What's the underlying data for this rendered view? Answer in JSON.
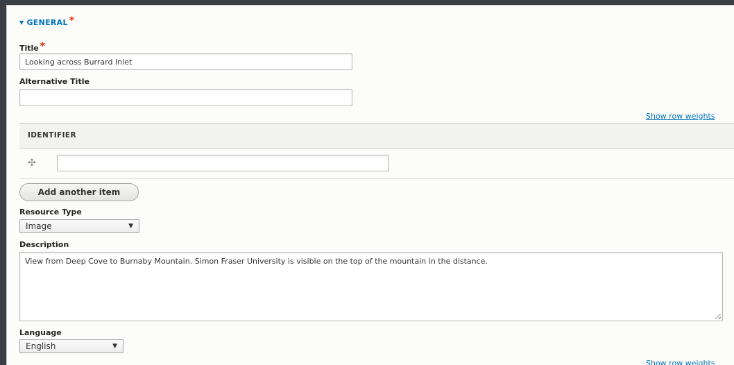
{
  "section": {
    "label": "GENERAL",
    "required_marker": "*"
  },
  "title": {
    "label": "Title",
    "required_marker": "*",
    "value": "Looking across Burrard Inlet"
  },
  "alternative_title": {
    "label": "Alternative Title",
    "value": ""
  },
  "identifier": {
    "show_weights": "Show row weights",
    "header": "IDENTIFIER",
    "value": ""
  },
  "add_item": {
    "label": "Add another item"
  },
  "resource_type": {
    "label": "Resource Type",
    "selected": "Image"
  },
  "description": {
    "label": "Description",
    "value": "View from Deep Cove to Burnaby Mountain. Simon Fraser University is visible on the top of the mountain in the distance."
  },
  "language": {
    "label": "Language",
    "selected": "English"
  },
  "bottom_show_weights": "Show row weights",
  "colors": {
    "link": "#0074bd",
    "required": "#e62600",
    "background": "#3a3f44"
  }
}
